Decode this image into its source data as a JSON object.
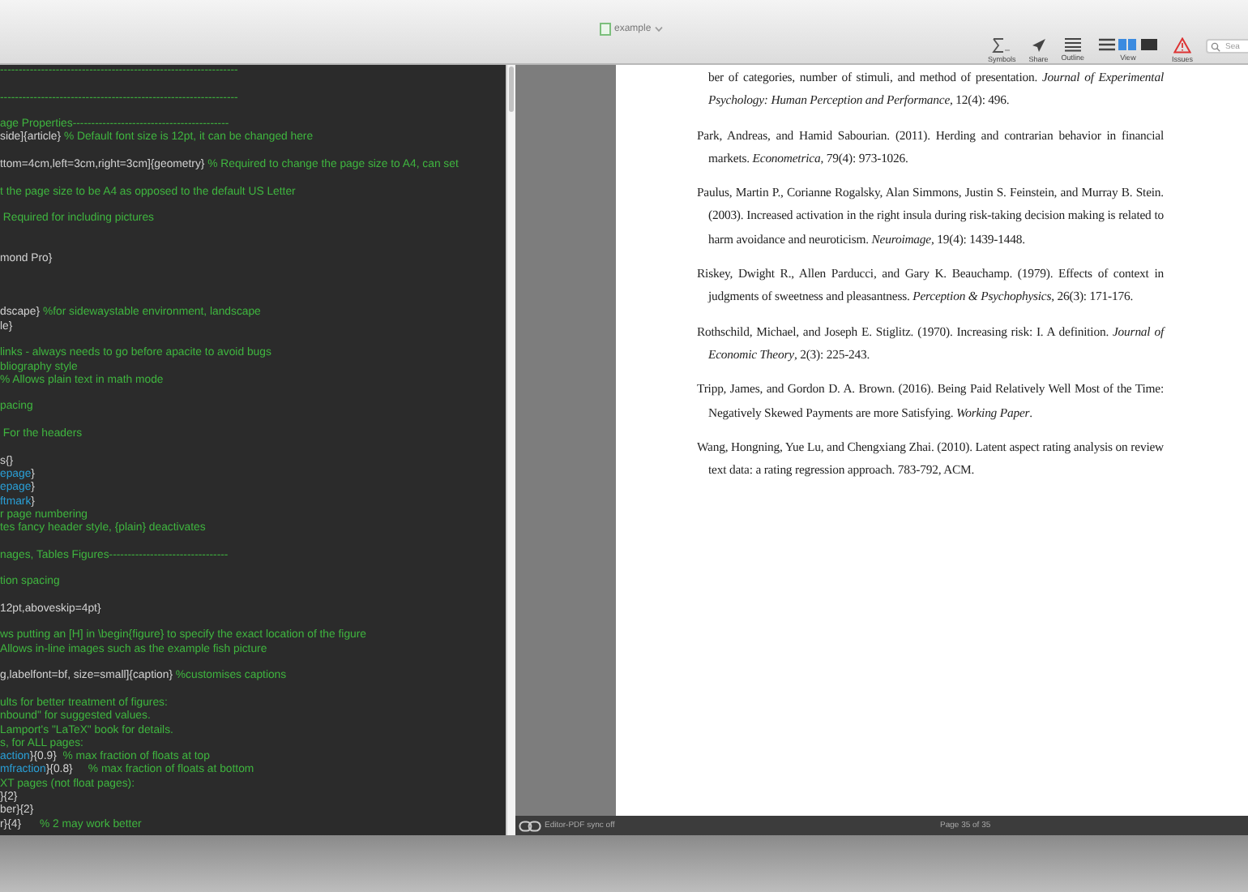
{
  "window": {
    "title": "example"
  },
  "toolbar": [
    {
      "kind": "symbols",
      "label": "Symbols"
    },
    {
      "kind": "share",
      "label": "Share"
    },
    {
      "kind": "outline",
      "label": "Outline"
    },
    {
      "kind": "view",
      "label": "View"
    },
    {
      "kind": "issues",
      "label": "Issues"
    }
  ],
  "search": {
    "placeholder": "Sea"
  },
  "editor": {
    "lines": [
      {
        "kind": "code",
        "segments": [
          {
            "kind": "comment",
            "text": "----------------------------------------------------------------"
          }
        ]
      },
      {
        "kind": "blank"
      },
      {
        "kind": "code",
        "segments": [
          {
            "kind": "comment",
            "text": "----------------------------------------------------------------"
          }
        ]
      },
      {
        "kind": "blank"
      },
      {
        "kind": "code",
        "segments": [
          {
            "kind": "comment",
            "text": "age Properties------------------------------------------"
          }
        ]
      },
      {
        "kind": "code",
        "segments": [
          {
            "kind": "code",
            "text": "side]{article}"
          },
          {
            "kind": "comment",
            "text": " % Default font size is 12pt, it can be changed here"
          }
        ]
      },
      {
        "kind": "blank"
      },
      {
        "kind": "code",
        "segments": [
          {
            "kind": "code",
            "text": "ttom=4cm,left=3cm,right=3cm]{geometry}"
          },
          {
            "kind": "comment",
            "text": " % Required to change the page size to A4, can set"
          }
        ]
      },
      {
        "kind": "blank"
      },
      {
        "kind": "code",
        "segments": [
          {
            "kind": "comment",
            "text": "t the page size to be A4 as opposed to the default US Letter"
          }
        ]
      },
      {
        "kind": "blank"
      },
      {
        "kind": "code",
        "segments": [
          {
            "kind": "comment",
            "text": " Required for including pictures"
          }
        ]
      },
      {
        "kind": "blank"
      },
      {
        "kind": "blank"
      },
      {
        "kind": "code",
        "segments": [
          {
            "kind": "code",
            "text": "mond Pro}"
          }
        ]
      },
      {
        "kind": "blank"
      },
      {
        "kind": "blank"
      },
      {
        "kind": "blank"
      },
      {
        "kind": "code",
        "segments": [
          {
            "kind": "code",
            "text": "dscape}"
          },
          {
            "kind": "comment",
            "text": " %for sidewaystable environment, landscape"
          }
        ]
      },
      {
        "kind": "code",
        "segments": [
          {
            "kind": "code",
            "text": "le}"
          }
        ]
      },
      {
        "kind": "blank"
      },
      {
        "kind": "code",
        "segments": [
          {
            "kind": "comment",
            "text": "links - always needs to go before apacite to avoid bugs"
          }
        ]
      },
      {
        "kind": "code",
        "segments": [
          {
            "kind": "comment",
            "text": "bliography style"
          }
        ]
      },
      {
        "kind": "code",
        "segments": [
          {
            "kind": "comment",
            "text": "% Allows plain text in math mode"
          }
        ]
      },
      {
        "kind": "blank"
      },
      {
        "kind": "code",
        "segments": [
          {
            "kind": "comment",
            "text": "pacing"
          }
        ]
      },
      {
        "kind": "blank"
      },
      {
        "kind": "code",
        "segments": [
          {
            "kind": "comment",
            "text": " For the headers"
          }
        ]
      },
      {
        "kind": "blank"
      },
      {
        "kind": "code",
        "segments": [
          {
            "kind": "code",
            "text": "s{}"
          }
        ]
      },
      {
        "kind": "code",
        "segments": [
          {
            "kind": "command",
            "text": "epage"
          },
          {
            "kind": "code",
            "text": "}"
          }
        ]
      },
      {
        "kind": "code",
        "segments": [
          {
            "kind": "command",
            "text": "epage"
          },
          {
            "kind": "code",
            "text": "}"
          }
        ]
      },
      {
        "kind": "code",
        "segments": [
          {
            "kind": "command",
            "text": "ftmark"
          },
          {
            "kind": "code",
            "text": "}"
          }
        ]
      },
      {
        "kind": "code",
        "segments": [
          {
            "kind": "comment",
            "text": "r page numbering"
          }
        ]
      },
      {
        "kind": "code",
        "segments": [
          {
            "kind": "comment",
            "text": "tes fancy header style, {plain} deactivates"
          }
        ]
      },
      {
        "kind": "blank"
      },
      {
        "kind": "code",
        "segments": [
          {
            "kind": "comment",
            "text": "nages, Tables Figures--------------------------------"
          }
        ]
      },
      {
        "kind": "blank"
      },
      {
        "kind": "code",
        "segments": [
          {
            "kind": "comment",
            "text": "tion spacing"
          }
        ]
      },
      {
        "kind": "blank"
      },
      {
        "kind": "code",
        "segments": [
          {
            "kind": "code",
            "text": "12pt,aboveskip=4pt}"
          }
        ]
      },
      {
        "kind": "blank"
      },
      {
        "kind": "code",
        "segments": [
          {
            "kind": "comment",
            "text": "ws putting an [H] in \\begin{figure} to specify the exact location of the figure"
          }
        ]
      },
      {
        "kind": "code",
        "segments": [
          {
            "kind": "comment",
            "text": "Allows in-line images such as the example fish picture"
          }
        ]
      },
      {
        "kind": "blank"
      },
      {
        "kind": "code",
        "segments": [
          {
            "kind": "code",
            "text": "g,labelfont=bf, size=small]{caption}"
          },
          {
            "kind": "comment",
            "text": " %customises captions"
          }
        ]
      },
      {
        "kind": "blank"
      },
      {
        "kind": "code",
        "segments": [
          {
            "kind": "comment",
            "text": "ults for better treatment of figures:"
          }
        ]
      },
      {
        "kind": "code",
        "segments": [
          {
            "kind": "comment",
            "text": "nbound\" for suggested values."
          }
        ]
      },
      {
        "kind": "code",
        "segments": [
          {
            "kind": "comment",
            "text": "Lamport's \"LaTeX\" book for details."
          }
        ]
      },
      {
        "kind": "code",
        "segments": [
          {
            "kind": "comment",
            "text": "s, for ALL pages:"
          }
        ]
      },
      {
        "kind": "code",
        "segments": [
          {
            "kind": "command",
            "text": "action"
          },
          {
            "kind": "code",
            "text": "}{0.9}"
          },
          {
            "kind": "comment",
            "text": "  % max fraction of floats at top"
          }
        ]
      },
      {
        "kind": "code",
        "segments": [
          {
            "kind": "command",
            "text": "mfraction"
          },
          {
            "kind": "code",
            "text": "}{0.8}"
          },
          {
            "kind": "comment",
            "text": "     % max fraction of floats at bottom"
          }
        ]
      },
      {
        "kind": "code",
        "segments": [
          {
            "kind": "comment",
            "text": "XT pages (not float pages):"
          }
        ]
      },
      {
        "kind": "code",
        "segments": [
          {
            "kind": "code",
            "text": "}{2}"
          }
        ]
      },
      {
        "kind": "code",
        "segments": [
          {
            "kind": "code",
            "text": "ber}{2}"
          }
        ]
      },
      {
        "kind": "code",
        "segments": [
          {
            "kind": "code",
            "text": "r}{4}"
          },
          {
            "kind": "comment",
            "text": "      % 2 may work better"
          }
        ]
      }
    ]
  },
  "pdf": {
    "references": [
      {
        "kind": "continuation",
        "text": "ber of categories, number of stimuli, and method of presentation. *Journal of Experimental Psychology: Human Perception and Performance*, 12(4): 496."
      },
      {
        "kind": "entry",
        "text": "Park, Andreas, and Hamid Sabourian. (2011). Herding and contrarian behavior in financial markets. *Econometrica*, 79(4): 973-1026."
      },
      {
        "kind": "entry",
        "text": "Paulus, Martin P., Corianne Rogalsky, Alan Simmons, Justin S. Feinstein, and Murray B. Stein. (2003). Increased activation in the right insula during risk-taking decision making is related to harm avoidance and neuroticism. *Neuroimage*, 19(4): 1439-1448."
      },
      {
        "kind": "entry",
        "text": "Riskey, Dwight R., Allen Parducci, and Gary K. Beauchamp. (1979). Effects of context in judgments of sweetness and pleasantness. *Perception & Psychophysics*, 26(3): 171-176."
      },
      {
        "kind": "entry",
        "text": "Rothschild, Michael, and Joseph E. Stiglitz. (1970). Increasing risk: I. A definition. *Journal of Economic Theory*, 2(3): 225-243."
      },
      {
        "kind": "entry",
        "text": "Tripp, James, and Gordon D. A. Brown. (2016). Being Paid Relatively Well Most of the Time: Negatively Skewed Payments are more Satisfying. *Working Paper*."
      },
      {
        "kind": "entry",
        "text": "Wang, Hongning, Yue Lu, and Chengxiang Zhai. (2010). Latent aspect rating analysis on review text data: a rating regression approach. 783-792, ACM."
      }
    ]
  },
  "status_bar": {
    "sync": "Editor-PDF sync off",
    "page": "Page 35 of 35"
  }
}
